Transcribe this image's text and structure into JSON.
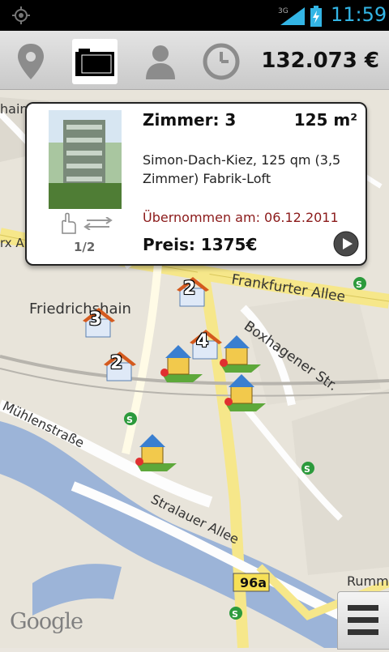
{
  "status_bar": {
    "time": "11:59",
    "network": "3G"
  },
  "toolbar": {
    "icons": [
      "location-pin-icon",
      "folder-icon",
      "person-icon",
      "clock-icon"
    ],
    "active": "folder-icon",
    "total_price": "132.073 €"
  },
  "popup": {
    "rooms": "Zimmer: 3",
    "area": "125 m²",
    "description": "Simon-Dach-Kiez, 125 qm (3,5 Zimmer) Fabrik-Loft",
    "accepted": "Übernommen am: 06.12.2011",
    "price": "Preis: 1375€",
    "counter": "1/2",
    "accent_color": "#8b1a1a"
  },
  "map": {
    "labels": {
      "frankfurter": "Frankfurter Allee",
      "friedrichshain": "Friedrichshain",
      "boxhagener": "Boxhagener Str.",
      "muehlen": "Mühlenstraße",
      "stralauer": "Stralauer Allee",
      "road_96a": "96a",
      "rumm": "Rumm",
      "hain": "hain",
      "rx": "rx A",
      "s": "S",
      "google": "Google"
    },
    "markers": {
      "house_a": "2",
      "house_b": "3",
      "house_c": "2",
      "house_d": "4"
    }
  }
}
